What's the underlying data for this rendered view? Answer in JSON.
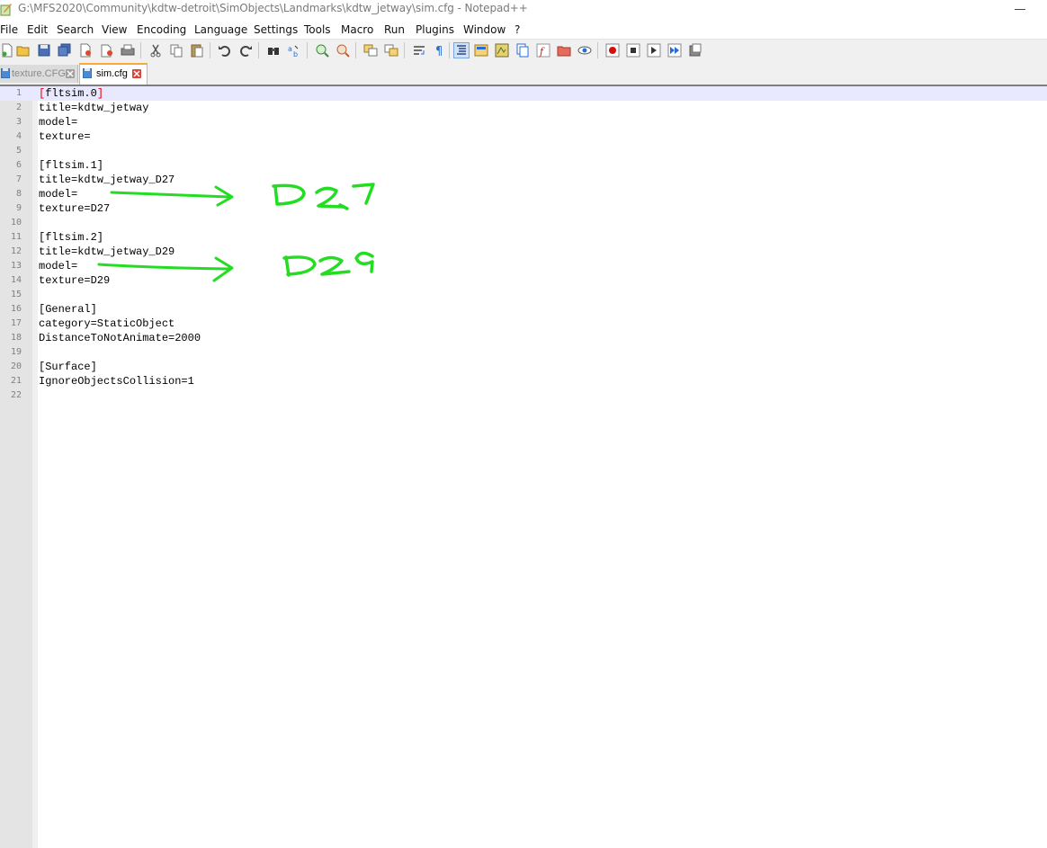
{
  "window": {
    "title": "G:\\MFS2020\\Community\\kdtw-detroit\\SimObjects\\Landmarks\\kdtw_jetway\\sim.cfg - Notepad++"
  },
  "menu": [
    "File",
    "Edit",
    "Search",
    "View",
    "Encoding",
    "Language",
    "Settings",
    "Tools",
    "Macro",
    "Run",
    "Plugins",
    "Window",
    "?"
  ],
  "toolbar": {
    "icons": [
      "new-file-icon",
      "open-file-icon",
      "save-icon",
      "save-all-icon",
      "close-icon",
      "close-all-icon",
      "print-icon",
      "cut-icon",
      "copy-icon",
      "paste-icon",
      "undo-icon",
      "redo-icon",
      "find-icon",
      "replace-icon",
      "zoom-in-icon",
      "zoom-out-icon",
      "sync-vertical-icon",
      "sync-horizontal-icon",
      "word-wrap-icon",
      "show-all-chars-icon",
      "indent-guide-icon",
      "udl-icon",
      "doc-map-icon",
      "doc-list-icon",
      "function-list-icon",
      "folder-workspace-icon",
      "monitoring-icon",
      "record-macro-icon",
      "stop-record-icon",
      "play-macro-icon",
      "run-macro-multiple-icon",
      "save-macro-icon"
    ]
  },
  "tabs": [
    {
      "label": "texture.CFG",
      "active": false
    },
    {
      "label": "sim.cfg",
      "active": true
    }
  ],
  "editor": {
    "lines": [
      "[fltsim.0]",
      "title=kdtw_jetway",
      "model=",
      "texture=",
      "",
      "[fltsim.1]",
      "title=kdtw_jetway_D27",
      "model=",
      "texture=D27",
      "",
      "[fltsim.2]",
      "title=kdtw_jetway_D29",
      "model=",
      "texture=D29",
      "",
      "[General]",
      "category=StaticObject",
      "DistanceToNotAnimate=2000",
      "",
      "[Surface]",
      "IgnoreObjectsCollision=1",
      ""
    ],
    "line_numbers": [
      "1",
      "2",
      "3",
      "4",
      "5",
      "6",
      "7",
      "8",
      "9",
      "10",
      "11",
      "12",
      "13",
      "14",
      "15",
      "16",
      "17",
      "18",
      "19",
      "20",
      "21",
      "22"
    ],
    "current_line": 1
  },
  "annotations": [
    {
      "handwritten_text": "D27",
      "color": "#22dd22"
    },
    {
      "handwritten_text": "D29",
      "color": "#22dd22"
    }
  ],
  "colors": {
    "annotation": "#22dd22",
    "active_tab_accent": "#f7a93b",
    "current_line": "#e8e8ff",
    "bracket_highlight": "#e00000"
  }
}
